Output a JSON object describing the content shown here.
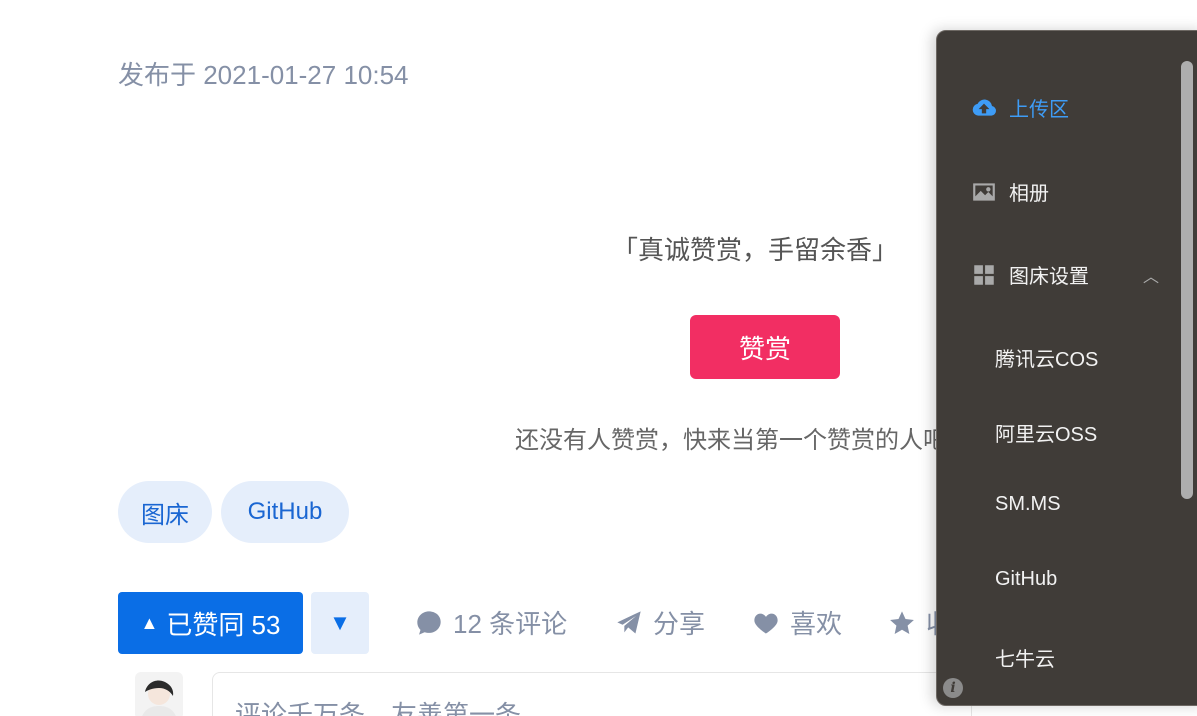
{
  "article": {
    "publish_time": "发布于 2021-01-27 10:54"
  },
  "reward": {
    "quote": "「真诚赞赏，手留余香」",
    "button_label": "赞赏",
    "empty_text": "还没有人赞赏，快来当第一个赞赏的人吧！"
  },
  "tags": [
    "图床",
    "GitHub"
  ],
  "actions": {
    "vote_up_label": "已赞同 53",
    "comments_label": "12 条评论",
    "share_label": "分享",
    "like_label": "喜欢",
    "favorite_label": "收"
  },
  "comment": {
    "placeholder": "评论千万条，友善第一条"
  },
  "panel": {
    "upload_label": "上传区",
    "album_label": "相册",
    "settings_label": "图床设置",
    "sub_items": [
      "腾讯云COS",
      "阿里云OSS",
      "SM.MS",
      "GitHub",
      "七牛云"
    ],
    "active_color": "#3e9cf6"
  },
  "colors": {
    "reward_button": "#f22e63",
    "vote_up": "#0a6ee6",
    "tag_bg": "#e5eefb",
    "panel_bg": "#403c38"
  }
}
